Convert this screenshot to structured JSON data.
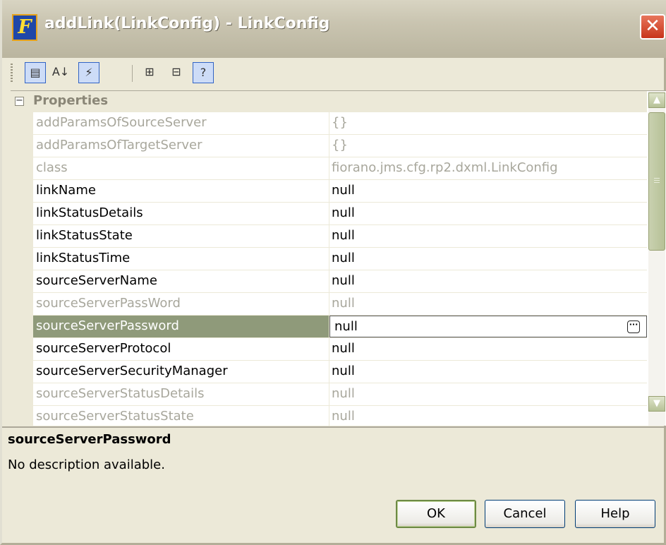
{
  "window": {
    "title": "addLink(LinkConfig) - LinkConfig",
    "app_icon": "F",
    "close_glyph": "✕"
  },
  "toolbar": {
    "buttons": [
      {
        "icon": "categorized-view-icon",
        "glyph": "▤",
        "pressed": true
      },
      {
        "icon": "sort-alphabetical-icon",
        "glyph": "A↓",
        "pressed": false
      },
      {
        "icon": "events-lightning-icon",
        "glyph": "⚡",
        "pressed": true
      },
      {
        "icon": "expand-all-icon",
        "glyph": "⊞",
        "pressed": false
      },
      {
        "icon": "collapse-all-icon",
        "glyph": "⊟",
        "pressed": false
      },
      {
        "icon": "help-description-icon",
        "glyph": "?",
        "pressed": true
      }
    ]
  },
  "properties": {
    "header": "Properties",
    "collapse_glyph": "−",
    "rows": [
      {
        "name": "addParamsOfSourceServer",
        "value": "{}",
        "editable": false
      },
      {
        "name": "addParamsOfTargetServer",
        "value": "{}",
        "editable": false
      },
      {
        "name": "class",
        "value": "fiorano.jms.cfg.rp2.dxml.LinkConfig",
        "editable": false
      },
      {
        "name": "linkName",
        "value": "null",
        "editable": true
      },
      {
        "name": "linkStatusDetails",
        "value": "null",
        "editable": true
      },
      {
        "name": "linkStatusState",
        "value": "null",
        "editable": true
      },
      {
        "name": "linkStatusTime",
        "value": "null",
        "editable": true
      },
      {
        "name": "sourceServerName",
        "value": "null",
        "editable": true
      },
      {
        "name": "sourceServerPassWord",
        "value": "null",
        "editable": false
      },
      {
        "name": "sourceServerPassword",
        "value": "null",
        "editable": true,
        "selected": true
      },
      {
        "name": "sourceServerProtocol",
        "value": "null",
        "editable": true
      },
      {
        "name": "sourceServerSecurityManager",
        "value": "null",
        "editable": true
      },
      {
        "name": "sourceServerStatusDetails",
        "value": "null",
        "editable": false
      },
      {
        "name": "sourceServerStatusState",
        "value": "null",
        "editable": false
      }
    ],
    "ellipsis_glyph": "···",
    "scroll_up_glyph": "▲",
    "scroll_down_glyph": "▼"
  },
  "description": {
    "title": "sourceServerPassword",
    "text": "No description available."
  },
  "buttons": {
    "ok": "OK",
    "cancel": "Cancel",
    "help": "Help"
  }
}
